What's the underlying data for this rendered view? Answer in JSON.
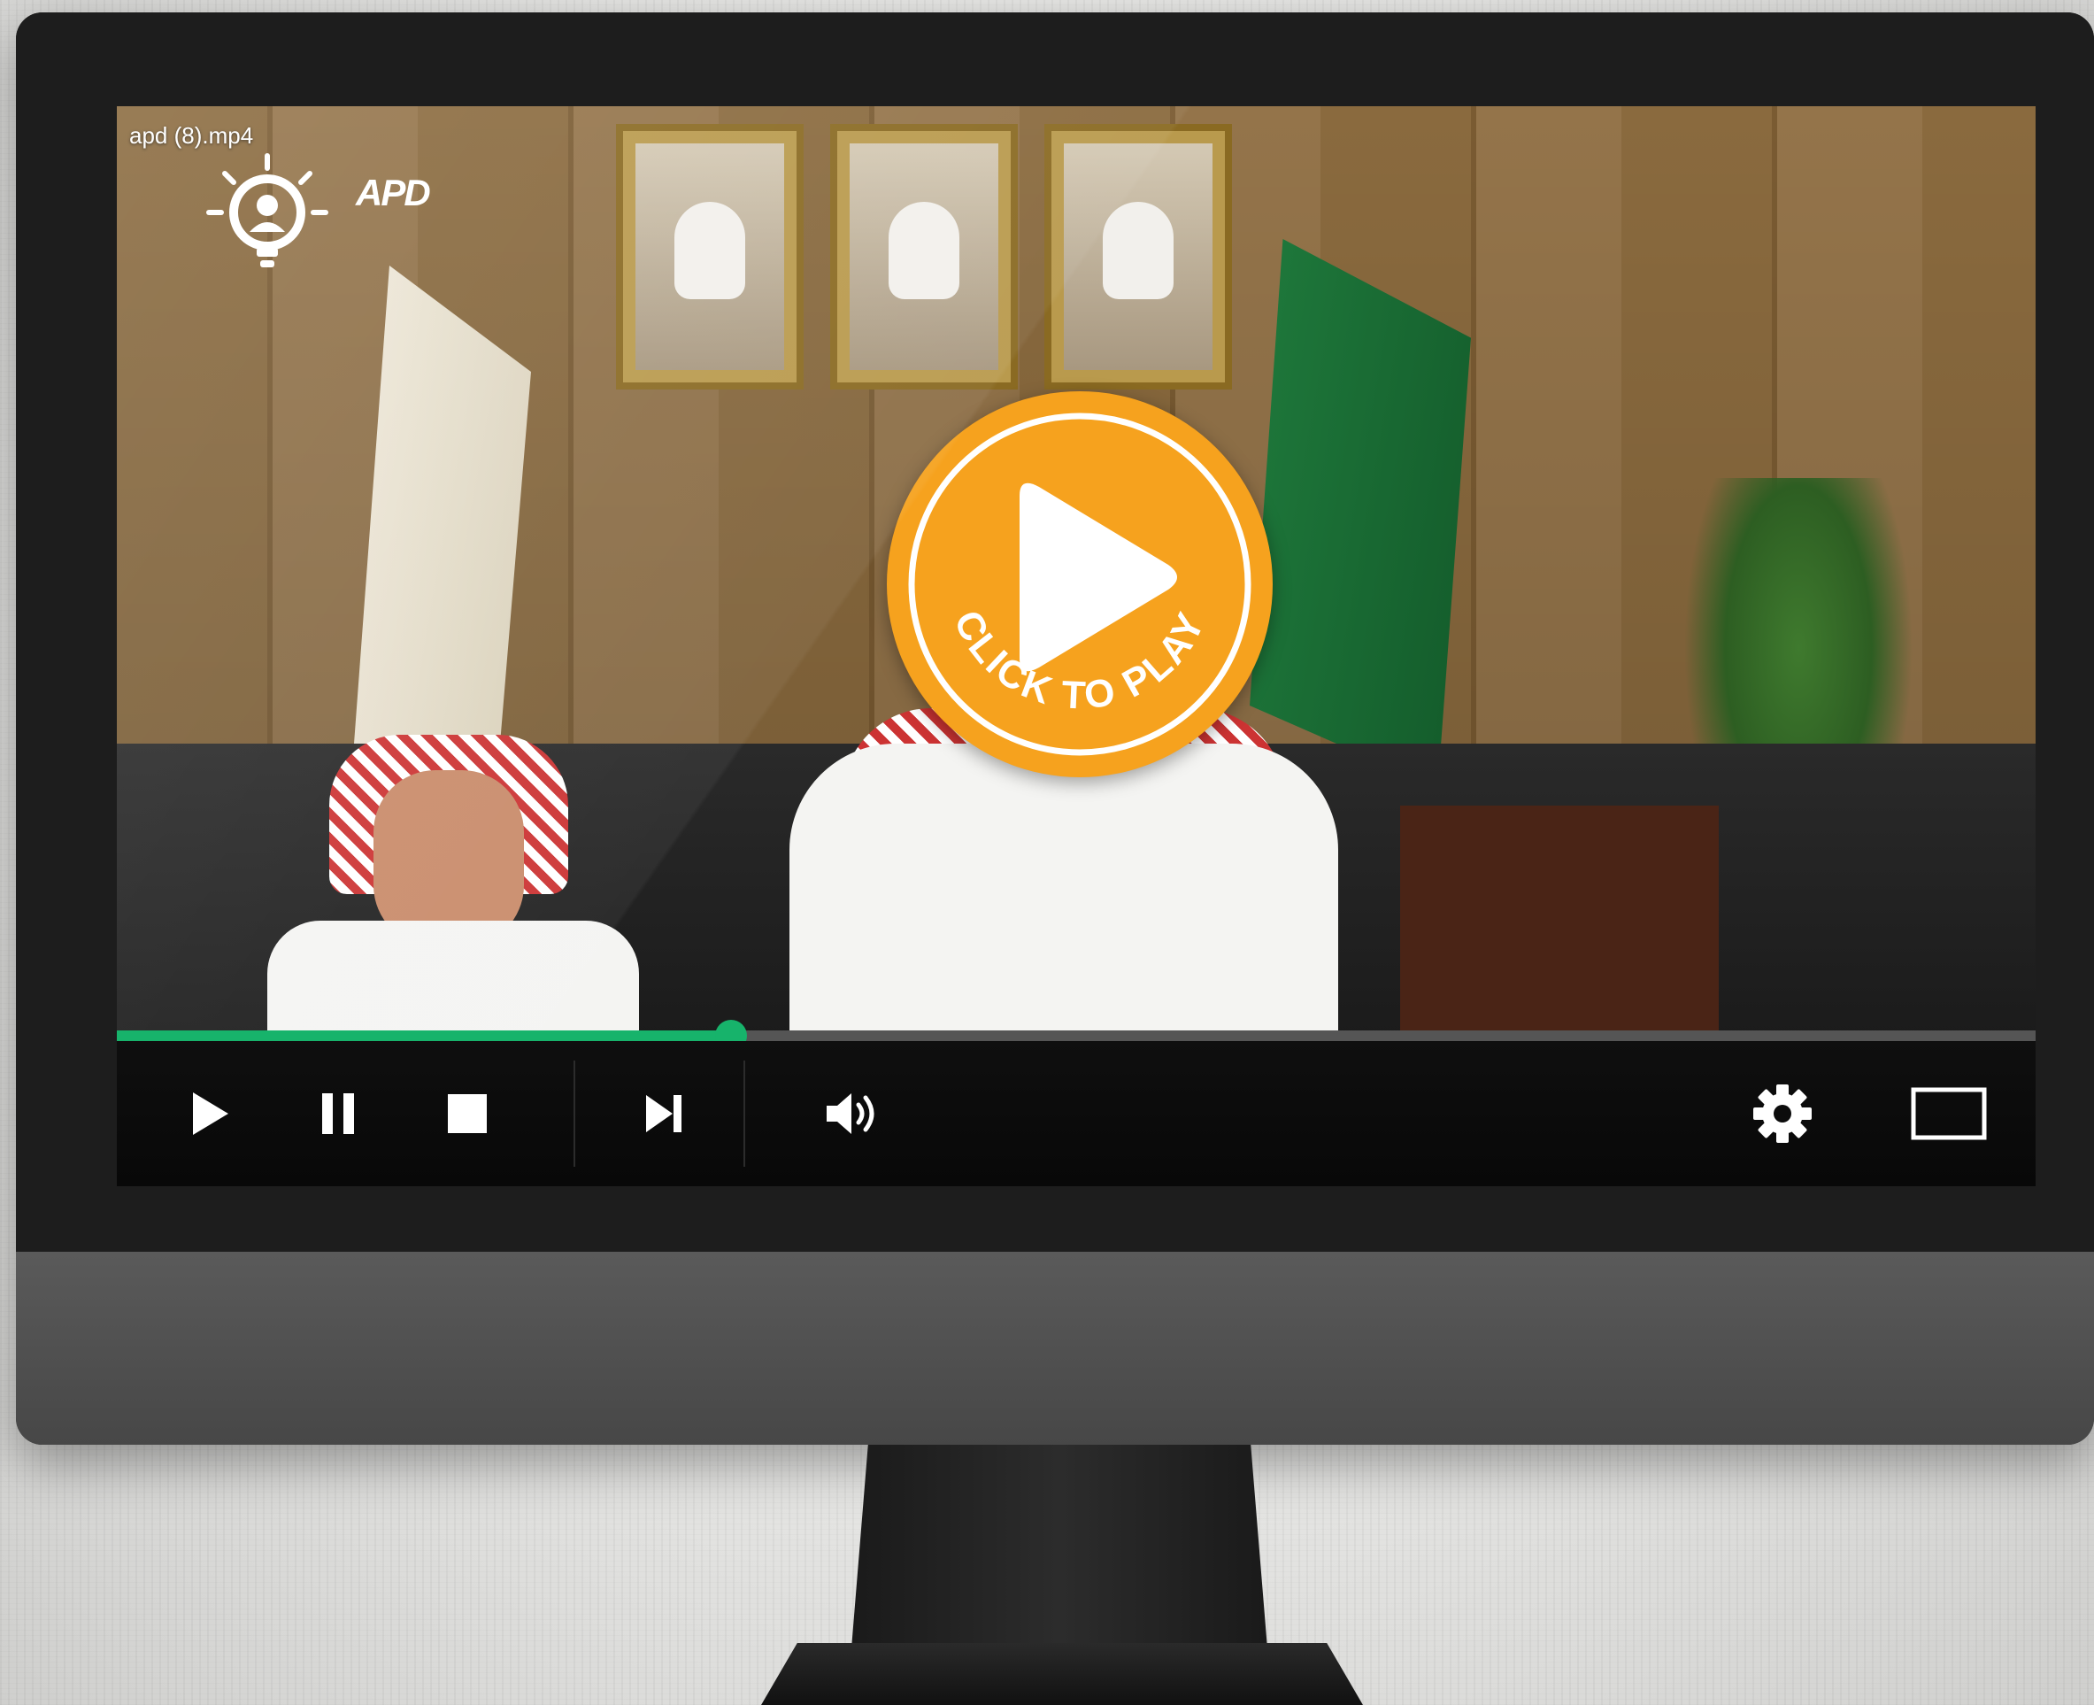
{
  "player": {
    "file_title": "apd (8).mp4",
    "logo_text": "APD",
    "overlay_label": "CLICK TO PLAY",
    "progress": 0.32,
    "accent_color": "#17b36b",
    "overlay_color": "#f6a21e"
  },
  "controls": {
    "buttons": [
      {
        "icon": "play-icon"
      },
      {
        "icon": "pause-icon"
      },
      {
        "icon": "stop-icon"
      },
      {
        "icon": "skip-next-icon"
      },
      {
        "icon": "volume-icon"
      },
      {
        "icon": "gear-icon"
      },
      {
        "icon": "fullscreen-icon"
      }
    ]
  }
}
